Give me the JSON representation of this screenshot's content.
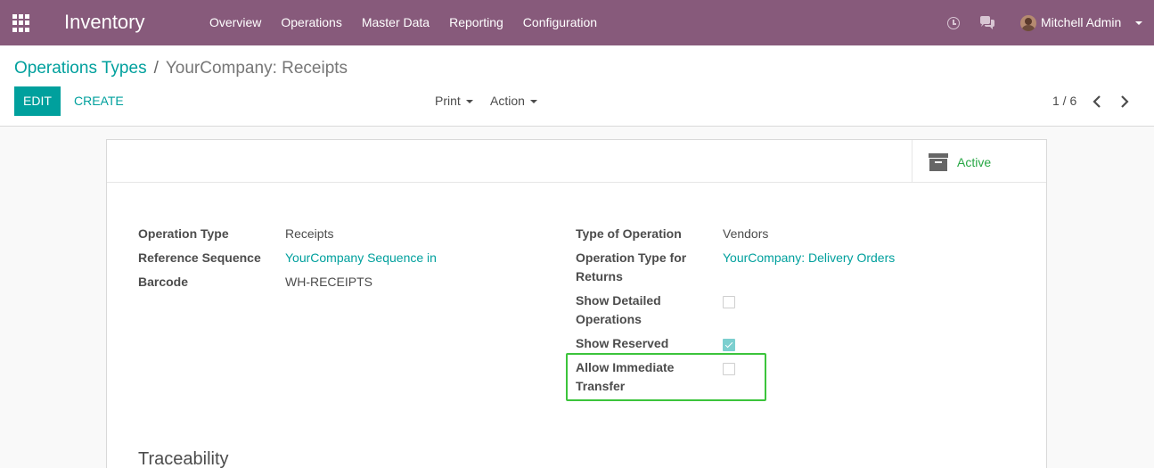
{
  "app": {
    "title": "Inventory",
    "menu": [
      "Overview",
      "Operations",
      "Master Data",
      "Reporting",
      "Configuration"
    ],
    "user_name": "Mitchell Admin",
    "brand_color": "#875a7b",
    "accent_color": "#00a09d"
  },
  "breadcrumb": {
    "parent": "Operations Types",
    "separator": "/",
    "current": "YourCompany: Receipts"
  },
  "toolbar": {
    "edit_label": "EDIT",
    "create_label": "CREATE",
    "print_label": "Print",
    "action_label": "Action",
    "pager_value": "1 / 6"
  },
  "button_box": {
    "active_label": "Active"
  },
  "form": {
    "left": [
      {
        "label": "Operation Type",
        "value": "Receipts"
      },
      {
        "label": "Reference Sequence",
        "value": "YourCompany Sequence in"
      },
      {
        "label": "Barcode",
        "value": "WH-RECEIPTS"
      }
    ],
    "right": {
      "type_of_operation": {
        "label": "Type of Operation",
        "value": "Vendors"
      },
      "return_type": {
        "label_line1": "Operation Type for",
        "label_line2": "Returns",
        "value": "YourCompany: Delivery Orders"
      },
      "show_detailed": {
        "label_line1": "Show Detailed",
        "label_line2": "Operations",
        "checked": false
      },
      "show_reserved": {
        "label": "Show Reserved",
        "checked": true
      },
      "allow_immediate": {
        "label_line1": "Allow Immediate",
        "label_line2": "Transfer",
        "checked": false
      }
    },
    "section_traceability": "Traceability"
  }
}
